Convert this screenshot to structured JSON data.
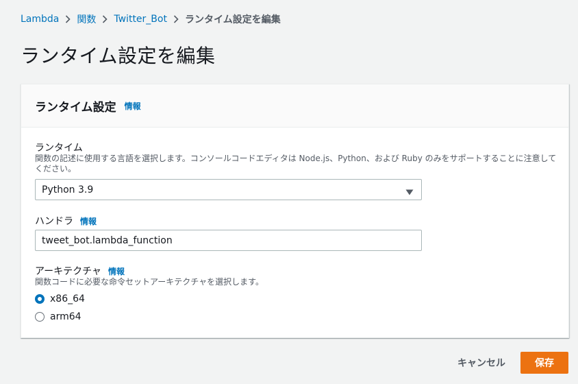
{
  "breadcrumb": {
    "items": [
      "Lambda",
      "関数",
      "Twitter_Bot"
    ],
    "current": "ランタイム設定を編集"
  },
  "page_title": "ランタイム設定を編集",
  "panel": {
    "title": "ランタイム設定",
    "info": "情報",
    "runtime": {
      "label": "ランタイム",
      "description": "関数の記述に使用する言語を選択します。コンソールコードエディタは Node.js、Python、および Ruby のみをサポートすることに注意してください。",
      "value": "Python 3.9"
    },
    "handler": {
      "label": "ハンドラ",
      "info": "情報",
      "value": "tweet_bot.lambda_function"
    },
    "architecture": {
      "label": "アーキテクチャ",
      "info": "情報",
      "description": "関数コードに必要な命令セットアーキテクチャを選択します。",
      "options": [
        {
          "label": "x86_64",
          "selected": true
        },
        {
          "label": "arm64",
          "selected": false
        }
      ]
    }
  },
  "actions": {
    "cancel": "キャンセル",
    "save": "保存"
  },
  "colors": {
    "link": "#0073bb",
    "primary": "#ec7211",
    "background": "#f2f3f3"
  }
}
